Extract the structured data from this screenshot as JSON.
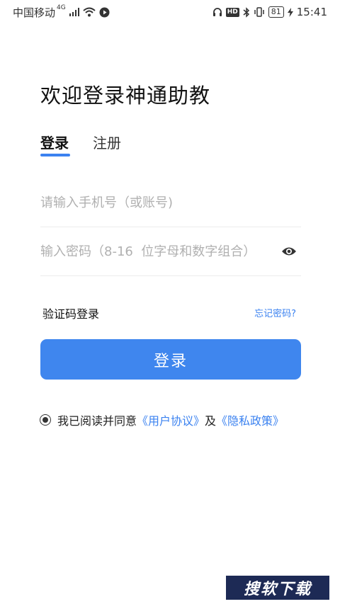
{
  "status_bar": {
    "carrier": "中国移动",
    "network": "4G",
    "battery": "81",
    "time": "15:41"
  },
  "page": {
    "title": "欢迎登录神通助教"
  },
  "tabs": [
    {
      "label": "登录",
      "active": true
    },
    {
      "label": "注册",
      "active": false
    }
  ],
  "form": {
    "phone_placeholder": "请输入手机号（或账号)",
    "password_placeholder": "输入密码（8-16  位字母和数字组合）",
    "sms_login_label": "验证码登录",
    "forgot_password_label": "忘记密码?",
    "submit_label": "登录"
  },
  "agreement": {
    "prefix": "我已阅读并同意",
    "terms_link": "《用户协议》",
    "conjunction": "及",
    "privacy_link": "《隐私政策》"
  },
  "watermark": {
    "text": "搜软下载"
  },
  "colors": {
    "accent": "#3f86ee",
    "link": "#3b82f0"
  },
  "icons": {
    "password_toggle": "eye-icon"
  }
}
